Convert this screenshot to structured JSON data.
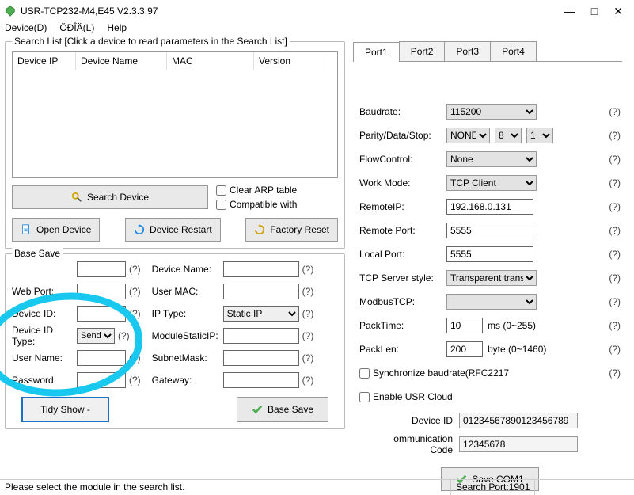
{
  "window": {
    "title": "USR-TCP232-M4,E45 V2.3.3.97",
    "minimize": "—",
    "maximize": "□",
    "close": "✕"
  },
  "menu": {
    "device": "Device(D)",
    "lang": "ÖÐÎÄ(L)",
    "help": "Help"
  },
  "search_list": {
    "legend": "Search List [Click a device to read parameters in the Search List]",
    "cols": {
      "ip": "Device IP",
      "name": "Device Name",
      "mac": "MAC",
      "ver": "Version"
    },
    "search_btn": "Search Device",
    "clear_arp": "Clear ARP table",
    "compatible": "Compatible with",
    "open_btn": "Open Device",
    "restart_btn": "Device Restart",
    "factory_btn": "Factory Reset"
  },
  "base": {
    "legend": "Base Save",
    "labels": {
      "blank1": "",
      "webport": "Web Port:",
      "devid": "Device ID:",
      "devidtype": "Device ID Type:",
      "username": "User Name:",
      "password": "Password:",
      "devname": "Device Name:",
      "usermac": "User MAC:",
      "iptype": "IP    Type:",
      "modip": "ModuleStaticIP:",
      "subnet": "SubnetMask:",
      "gateway": "Gateway:"
    },
    "values": {
      "devidtype": "Send",
      "iptype": "Static IP"
    },
    "tidy_btn": "Tidy Show  -",
    "save_btn": "Base Save",
    "q": "(?)"
  },
  "port": {
    "tabs": [
      "Port1",
      "Port2",
      "Port3",
      "Port4"
    ],
    "labels": {
      "baud": "Baudrate:",
      "pds": "Parity/Data/Stop:",
      "flow": "FlowControl:",
      "workmode": "Work Mode:",
      "remoteip": "RemoteIP:",
      "remoteport": "Remote Port:",
      "localport": "Local Port:",
      "tcpstyle": "TCP Server style:",
      "modbus": "ModbusTCP:",
      "packtime": "PackTime:",
      "packlen": "PackLen:",
      "syncrfc": "Synchronize baudrate(RFC2217",
      "enablecloud": "Enable USR Cloud",
      "devid_sub": "Device ID",
      "commcode": "ommunication Code"
    },
    "values": {
      "baud": "115200",
      "parity": "NONE",
      "databits": "8",
      "stopbits": "1",
      "flow": "None",
      "workmode": "TCP Client",
      "remoteip": "192.168.0.131",
      "remoteport": "5555",
      "localport": "5555",
      "tcpstyle": "Transparent transmi",
      "modbus": "",
      "packtime": "10",
      "packlen": "200",
      "cloud_devid": "01234567890123456789",
      "cloud_code": "12345678"
    },
    "hints": {
      "packtime": "ms (0~255)",
      "packlen": "byte (0~1460)"
    },
    "save_btn": "Save COM1",
    "q": "(?)"
  },
  "status": {
    "msg": "Please select the module in the search list.",
    "port": "Search Port:1901"
  }
}
